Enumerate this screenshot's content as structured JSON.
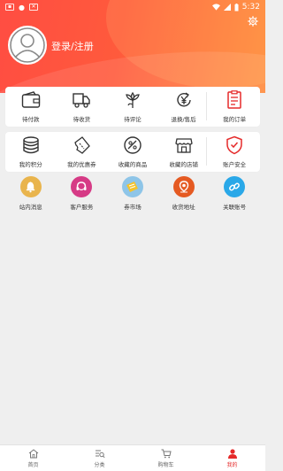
{
  "status_bar": {
    "time": "5:32"
  },
  "profile": {
    "login_label": "登录/注册"
  },
  "orders_row": [
    {
      "label": "待付款",
      "icon": "wallet-icon"
    },
    {
      "label": "待收货",
      "icon": "truck-icon"
    },
    {
      "label": "待评论",
      "icon": "flower-icon"
    },
    {
      "label": "退换/售后",
      "icon": "yen-return-icon"
    },
    {
      "label": "我的订单",
      "icon": "order-list-icon"
    }
  ],
  "assets_row": [
    {
      "label": "我的积分",
      "icon": "coins-icon"
    },
    {
      "label": "我的优惠券",
      "icon": "coupon-icon"
    },
    {
      "label": "收藏的商品",
      "icon": "collect-goods-icon"
    },
    {
      "label": "收藏的店铺",
      "icon": "store-icon"
    },
    {
      "label": "账户安全",
      "icon": "shield-icon"
    }
  ],
  "services_row": [
    {
      "label": "站内消息",
      "icon": "bell-icon",
      "color": "#e9b44c"
    },
    {
      "label": "客户服务",
      "icon": "headset-icon",
      "color": "#d63b86"
    },
    {
      "label": "券市场",
      "icon": "ticket-icon",
      "color": "#8ec5e8"
    },
    {
      "label": "收货地址",
      "icon": "location-icon",
      "color": "#e55a22"
    },
    {
      "label": "关联账号",
      "icon": "link-icon",
      "color": "#2aa8e8"
    }
  ],
  "bottom_nav": [
    {
      "label": "首页",
      "icon": "home-icon",
      "active": false
    },
    {
      "label": "分类",
      "icon": "category-search-icon",
      "active": false
    },
    {
      "label": "购物车",
      "icon": "cart-icon",
      "active": false
    },
    {
      "label": "我的",
      "icon": "person-icon",
      "active": true
    }
  ],
  "colors": {
    "brand": "#ff4d42",
    "accent_red": "#e52a2a"
  }
}
